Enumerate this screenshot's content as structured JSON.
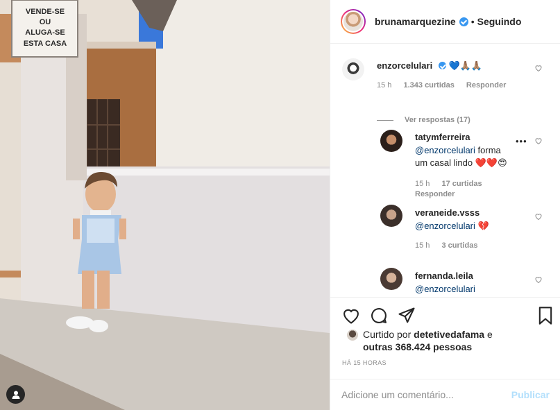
{
  "header": {
    "username": "brunamarquezine",
    "separator": "•",
    "follow_status": "Seguindo"
  },
  "photo": {
    "sign_lines": [
      "VENDE-SE",
      "OU",
      "ALUGA-SE",
      "ESTA CASA"
    ]
  },
  "comments": [
    {
      "username": "enzorcelulari",
      "text": "💙🙏🏽🙏🏽",
      "time": "15 h",
      "likes": "1.343 curtidas",
      "reply": "Responder",
      "view_replies": "Ver respostas (17)"
    },
    {
      "username": "tatymferreira",
      "mention": "@enzorcelulari",
      "text_line1": "forma",
      "text_line2": "um casal lindo ❤️❤️😍",
      "time": "15 h",
      "likes": "17 curtidas",
      "reply": "Responder",
      "more": "•••"
    },
    {
      "username": "veraneide.vsss",
      "mention": "@enzorcelulari",
      "text": "💔",
      "time": "15 h",
      "likes": "3 curtidas",
      "reply": "Responder"
    },
    {
      "username": "fernanda.leila",
      "mention": "@enzorcelulari"
    }
  ],
  "likes": {
    "prefix": "Curtido por",
    "user": "detetivedafama",
    "middle": "e",
    "others": "outras 368.424 pessoas"
  },
  "time_ago": "HÁ 15 HORAS",
  "add_comment": {
    "placeholder": "Adicione um comentário...",
    "publish": "Publicar"
  },
  "colors": {
    "verified": "#3897f0",
    "mention": "#00376b",
    "publish_disabled": "#b2dffc",
    "muted": "#8e8e8e"
  },
  "icons": [
    "heart-icon",
    "comment-icon",
    "share-icon",
    "bookmark-icon",
    "tag-user-icon",
    "verified-icon"
  ]
}
